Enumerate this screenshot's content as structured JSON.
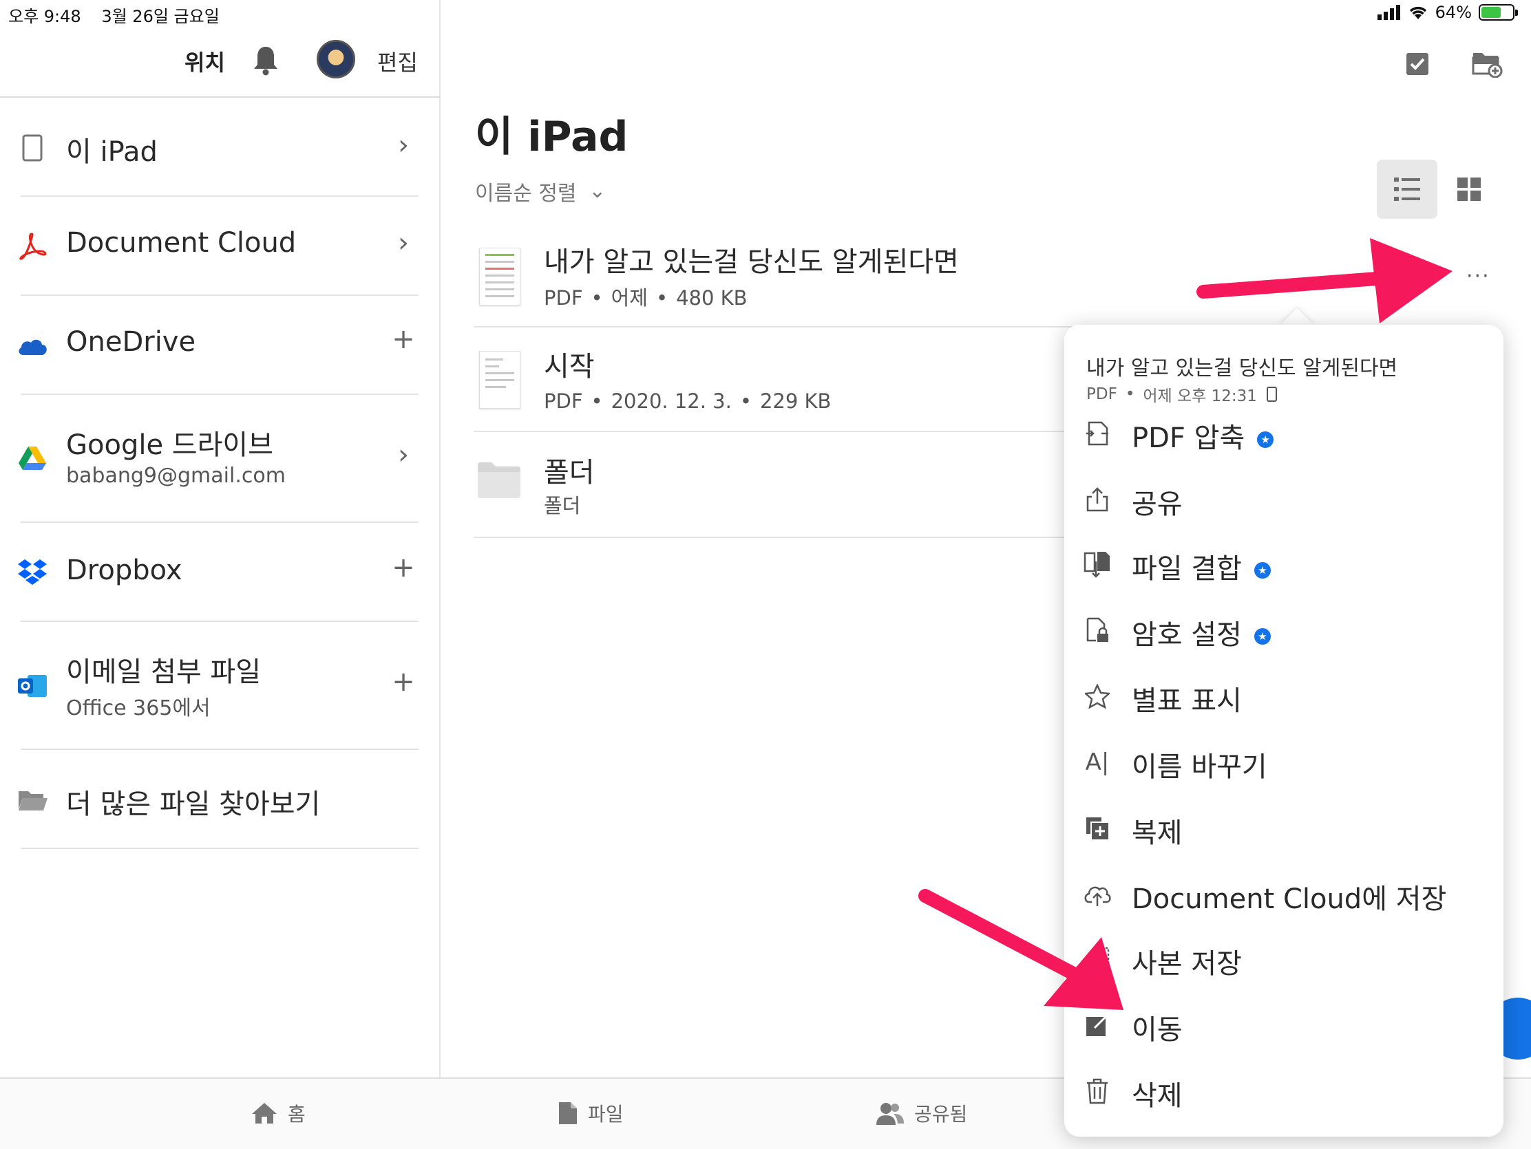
{
  "status_bar": {
    "time": "오후 9:48",
    "date": "3월 26일 금요일",
    "battery": "64%",
    "battery_level": 0.64
  },
  "sidebar": {
    "header_title": "위치",
    "edit_label": "편집",
    "items": [
      {
        "label": "이 iPad",
        "sub": "",
        "trail": "chevron",
        "icon": "ipad-icon"
      },
      {
        "label": "Document Cloud",
        "sub": "",
        "trail": "chevron",
        "icon": "acrobat-icon"
      },
      {
        "label": "OneDrive",
        "sub": "",
        "trail": "plus",
        "icon": "onedrive-icon"
      },
      {
        "label": "Google 드라이브",
        "sub": "babang9@gmail.com",
        "trail": "chevron",
        "icon": "google-drive-icon"
      },
      {
        "label": "Dropbox",
        "sub": "",
        "trail": "plus",
        "icon": "dropbox-icon"
      },
      {
        "label": "이메일 첨부 파일",
        "sub": "Office 365에서",
        "trail": "plus",
        "icon": "outlook-icon"
      },
      {
        "label": "더 많은 파일 찾아보기",
        "sub": "",
        "trail": "",
        "icon": "folder-open-icon"
      }
    ]
  },
  "main": {
    "title": "이 iPad",
    "sort_label": "이름순 정렬",
    "files": [
      {
        "name": "내가 알고 있는걸 당신도 알게된다면",
        "type": "PDF",
        "date": "어제",
        "size": "480 KB"
      },
      {
        "name": "시작",
        "type": "PDF",
        "date": "2020. 12. 3.",
        "size": "229 KB"
      },
      {
        "name": "폴더",
        "type": "폴더",
        "date": "",
        "size": ""
      }
    ],
    "more_label": "···"
  },
  "context_menu": {
    "file_name": "내가 알고 있는걸 당신도 알게된다면",
    "file_type": "PDF",
    "file_time": "어제 오후 12:31",
    "items": [
      {
        "label": "PDF 압축",
        "icon": "compress-pdf-icon",
        "premium": true
      },
      {
        "label": "공유",
        "icon": "share-icon",
        "premium": false
      },
      {
        "label": "파일 결합",
        "icon": "combine-files-icon",
        "premium": true
      },
      {
        "label": "암호 설정",
        "icon": "password-lock-icon",
        "premium": true
      },
      {
        "label": "별표 표시",
        "icon": "star-icon",
        "premium": false
      },
      {
        "label": "이름 바꾸기",
        "icon": "rename-icon",
        "premium": false
      },
      {
        "label": "복제",
        "icon": "duplicate-icon",
        "premium": false
      },
      {
        "label": "Document Cloud에 저장",
        "icon": "cloud-upload-icon",
        "premium": false
      },
      {
        "label": "사본 저장",
        "icon": "save-copy-icon",
        "premium": false
      },
      {
        "label": "이동",
        "icon": "move-icon",
        "premium": false
      },
      {
        "label": "삭제",
        "icon": "trash-icon",
        "premium": false
      }
    ]
  },
  "tabbar": {
    "home": "홈",
    "files": "파일",
    "shared": "공유됨"
  },
  "colors": {
    "annotation_arrow": "#f5185a",
    "premium_badge": "#1473e6",
    "acrobat_red": "#e0261a"
  }
}
